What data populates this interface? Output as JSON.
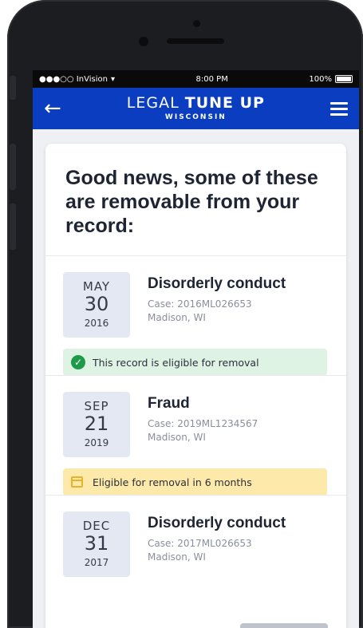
{
  "status_bar": {
    "carrier": "●●●○○ InVision",
    "wifi": "▾",
    "time": "8:00 PM",
    "battery": "100%"
  },
  "app_bar": {
    "logo_prefix": "LEGAL ",
    "logo_bold": "TUNE UP",
    "logo_sub": "WISCONSIN",
    "brand_color": "#0a3dbf"
  },
  "heading": "Good news, some of these are removable from your record:",
  "records": [
    {
      "month": "MAY",
      "day": "30",
      "year": "2016",
      "title": "Disorderly conduct",
      "case": "Case: 2016ML026653",
      "location": "Madison, WI",
      "status": "This record is eligible for removal",
      "status_type": "eligible"
    },
    {
      "month": "SEP",
      "day": "21",
      "year": "2019",
      "title": "Fraud",
      "case": "Case: 2019ML1234567",
      "location": "Madison, WI",
      "status": "Eligible for removal in 6 months",
      "status_type": "pending"
    },
    {
      "month": "DEC",
      "day": "31",
      "year": "2017",
      "title": "Disorderly conduct",
      "case": "Case: 2017ML026653",
      "location": "Madison, WI"
    }
  ],
  "icons": {
    "back": "arrow-left-icon",
    "menu": "hamburger-menu-icon",
    "eligible": "check-circle-icon",
    "pending": "calendar-icon"
  }
}
